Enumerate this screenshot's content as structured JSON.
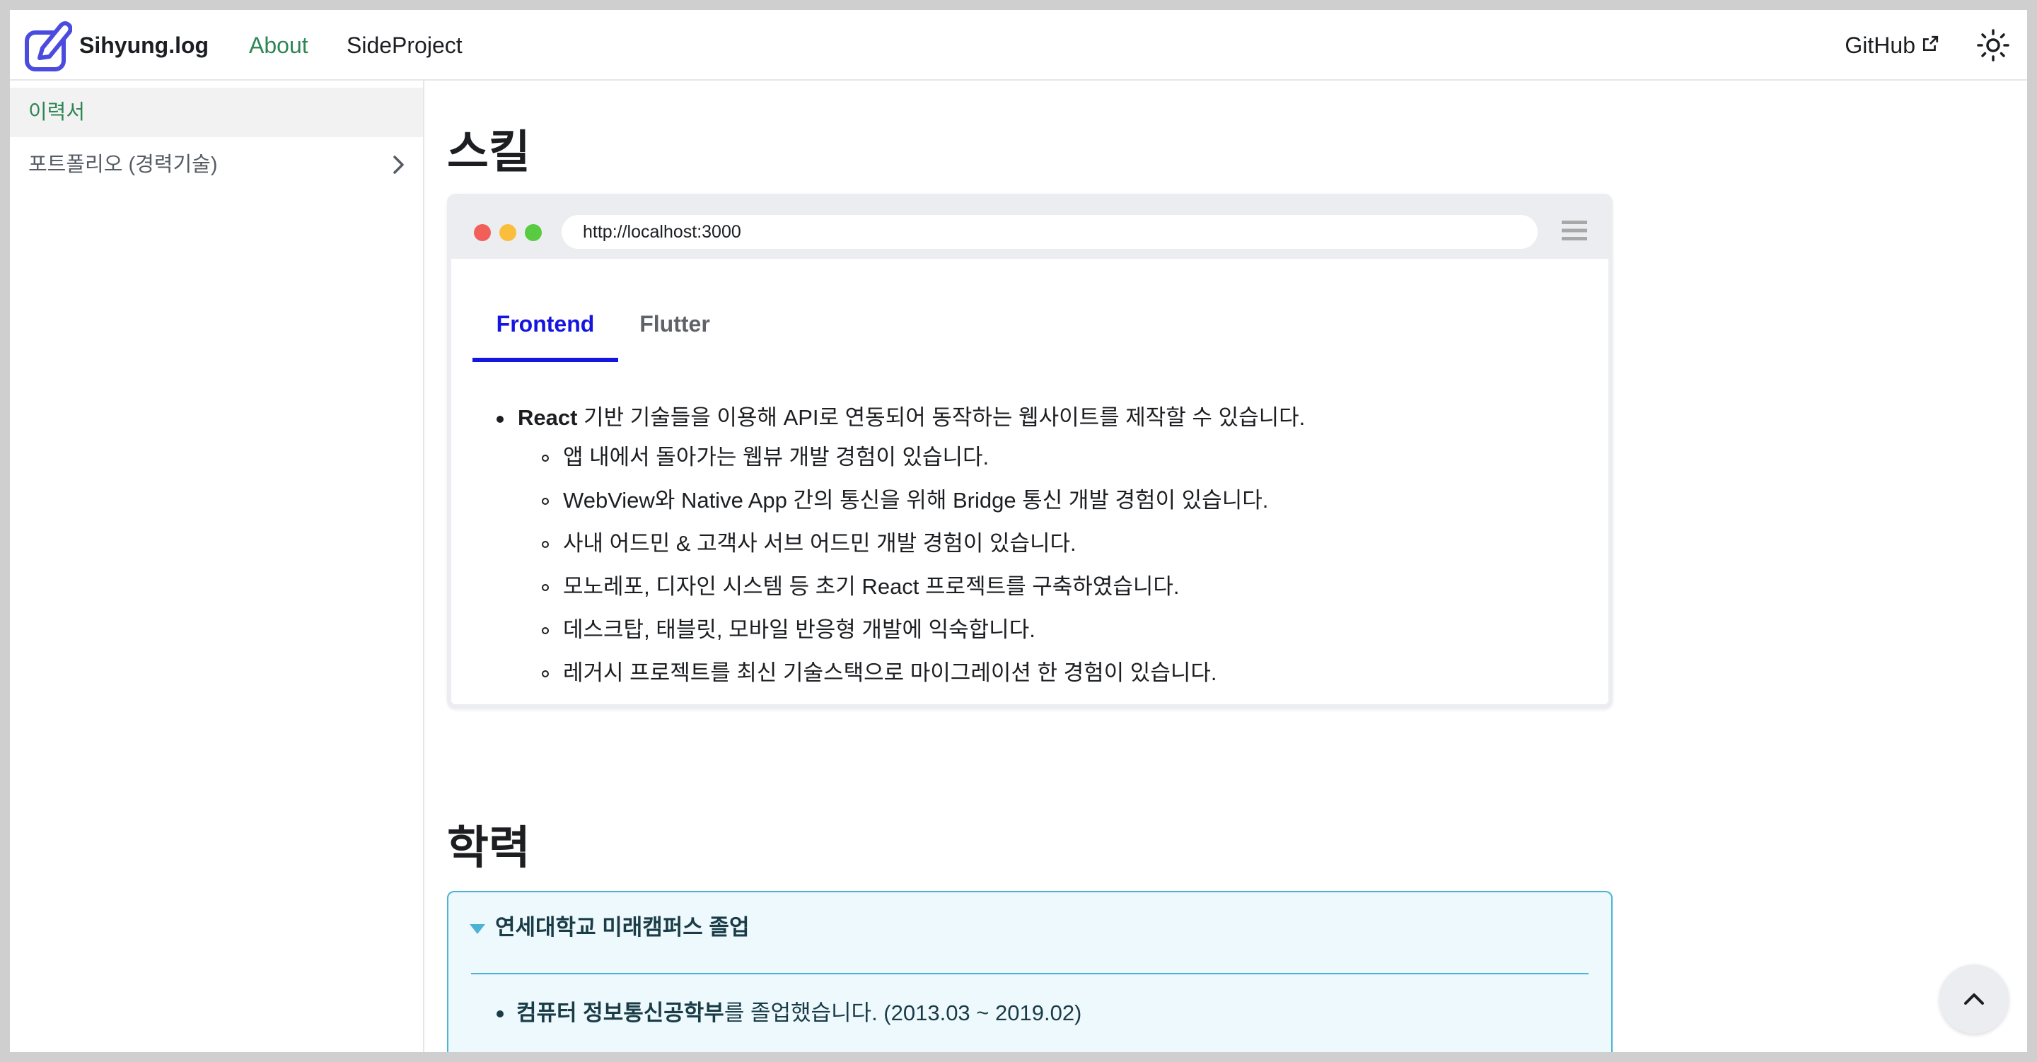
{
  "navbar": {
    "brand": "Sihyung.log",
    "links": [
      "About",
      "SideProject"
    ],
    "github": "GitHub"
  },
  "sidebar": {
    "items": [
      {
        "label": "이력서",
        "active": true
      },
      {
        "label": "포트폴리오 (경력기술)",
        "expandable": true
      }
    ]
  },
  "main": {
    "skill_heading": "스킬",
    "browser": {
      "url": "http://localhost:3000",
      "tabs": [
        "Frontend",
        "Flutter"
      ],
      "active_tab": "Frontend",
      "main_bullet_bold": "React",
      "main_bullet_rest": " 기반 기술들을 이용해 API로 연동되어 동작하는 웹사이트를 제작할 수 있습니다.",
      "sub_bullets": [
        "앱 내에서 돌아가는 웹뷰 개발 경험이 있습니다.",
        "WebView와 Native App 간의 통신을 위해 Bridge 통신 개발 경험이 있습니다.",
        "사내 어드민 & 고객사 서브 어드민 개발 경험이 있습니다.",
        "모노레포, 디자인 시스템 등 초기 React 프로젝트를 구축하였습니다.",
        "데스크탑, 태블릿, 모바일 반응형 개발에 익숙합니다.",
        "레거시 프로젝트를 최신 기술스택으로 마이그레이션 한 경험이 있습니다."
      ]
    },
    "education_heading": "학력",
    "education": {
      "summary": "연세대학교 미래캠퍼스 졸업",
      "item_bold": "컴퓨터 정보통신공학부",
      "item_rest": "를 졸업했습니다. (2013.03 ~ 2019.02)"
    }
  },
  "colors": {
    "accent_green": "#2e8555",
    "tab_blue": "#1515e0",
    "info_border": "#4cb3d4",
    "info_bg": "#eef9fd"
  }
}
